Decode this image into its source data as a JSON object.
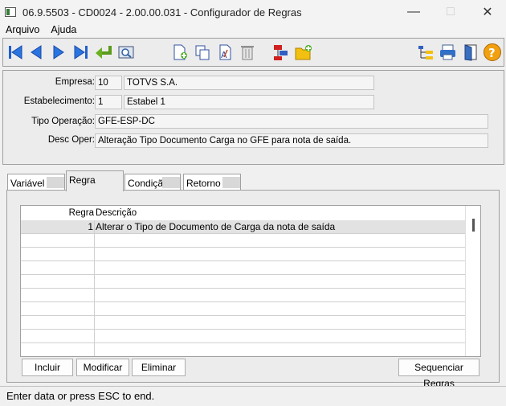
{
  "window": {
    "title": "06.9.5503 - CD0024 - 2.00.00.031 - Configurador de Regras"
  },
  "menu": {
    "items": [
      "Arquivo",
      "Ajuda"
    ]
  },
  "toolbar": {
    "left_icons": [
      "first-record-icon",
      "previous-record-icon",
      "next-record-icon",
      "last-record-icon",
      "go-to-icon",
      "search-icon"
    ],
    "mid_icons": [
      "new-document-icon",
      "copy-icon",
      "edit-document-icon",
      "delete-icon",
      "rules-icon",
      "new-folder-icon"
    ],
    "right_icons": [
      "tree-icon",
      "print-icon",
      "exit-icon",
      "help-icon"
    ]
  },
  "header": {
    "empresa": {
      "label": "Empresa:",
      "code": "10",
      "name": "TOTVS S.A."
    },
    "estabelecimento": {
      "label": "Estabelecimento:",
      "code": "1",
      "name": "Estabel 1"
    },
    "tipo_operacao": {
      "label": "Tipo Operação:",
      "value": "GFE-ESP-DC"
    },
    "desc_oper": {
      "label": "Desc Oper:",
      "value": "Alteração Tipo Documento Carga no GFE para nota de saída."
    }
  },
  "tabs": [
    {
      "label": "Variável",
      "active": false
    },
    {
      "label": "Regra",
      "active": true
    },
    {
      "label": "Condição",
      "active": false
    },
    {
      "label": "Retorno",
      "active": false
    }
  ],
  "grid": {
    "columns": [
      "Regra",
      "Descrição"
    ],
    "rows": [
      {
        "regra": "1",
        "descricao": "Alterar o Tipo de Documento de Carga da nota de saída"
      }
    ]
  },
  "buttons": {
    "incluir": "Incluir",
    "modificar": "Modificar",
    "eliminar": "Eliminar",
    "sequenciar": "Sequenciar Regras"
  },
  "status": {
    "text": "Enter data or press ESC to end."
  }
}
